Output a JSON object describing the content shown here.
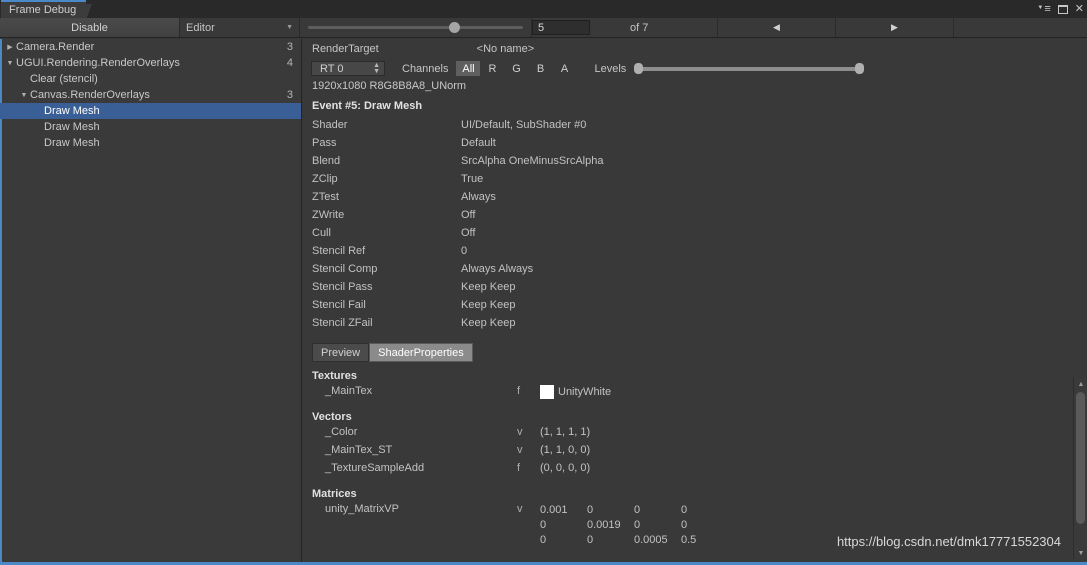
{
  "window": {
    "tab_title": "Frame Debug",
    "controls": {
      "menu": "menu-icon",
      "maximize": "maximize-icon",
      "close": "✕"
    }
  },
  "toolbar": {
    "disable_label": "Disable",
    "target_dropdown": "Editor",
    "frame_value": "5",
    "frame_total": "of 7",
    "prev_label": "◀",
    "next_label": "▶",
    "slider_percent": 68
  },
  "tree": {
    "items": [
      {
        "label": "Camera.Render",
        "count": "3",
        "arrow": "▶",
        "indent": 0,
        "selected": false
      },
      {
        "label": "UGUI.Rendering.RenderOverlays",
        "count": "4",
        "arrow": "▼",
        "indent": 0,
        "selected": false
      },
      {
        "label": "Clear (stencil)",
        "count": "",
        "arrow": "",
        "indent": 1,
        "selected": false
      },
      {
        "label": "Canvas.RenderOverlays",
        "count": "3",
        "arrow": "▼",
        "indent": 1,
        "selected": false
      },
      {
        "label": "Draw Mesh",
        "count": "",
        "arrow": "",
        "indent": 2,
        "selected": true
      },
      {
        "label": "Draw Mesh",
        "count": "",
        "arrow": "",
        "indent": 2,
        "selected": false
      },
      {
        "label": "Draw Mesh",
        "count": "",
        "arrow": "",
        "indent": 2,
        "selected": false
      }
    ]
  },
  "detail": {
    "render_target_label": "RenderTarget",
    "render_target_value": "<No name>",
    "rt_index": "RT 0",
    "channels_label": "Channels",
    "channels": [
      "All",
      "R",
      "G",
      "B",
      "A"
    ],
    "channel_active": "All",
    "levels_label": "Levels",
    "rt_format": "1920x1080 R8G8B8A8_UNorm",
    "event_title": "Event #5: Draw Mesh",
    "properties": [
      {
        "key": "Shader",
        "value": "UI/Default, SubShader #0"
      },
      {
        "key": "Pass",
        "value": "Default"
      },
      {
        "key": "Blend",
        "value": "SrcAlpha OneMinusSrcAlpha"
      },
      {
        "key": "ZClip",
        "value": "True"
      },
      {
        "key": "ZTest",
        "value": "Always"
      },
      {
        "key": "ZWrite",
        "value": "Off"
      },
      {
        "key": "Cull",
        "value": "Off"
      },
      {
        "key": "Stencil Ref",
        "value": "0"
      },
      {
        "key": "Stencil Comp",
        "value": "Always Always"
      },
      {
        "key": "Stencil Pass",
        "value": "Keep Keep"
      },
      {
        "key": "Stencil Fail",
        "value": "Keep Keep"
      },
      {
        "key": "Stencil ZFail",
        "value": "Keep Keep"
      }
    ],
    "tabs": [
      {
        "label": "Preview",
        "active": false
      },
      {
        "label": "ShaderProperties",
        "active": true
      }
    ],
    "textures_header": "Textures",
    "textures": [
      {
        "name": "_MainTex",
        "type": "f",
        "value": "UnityWhite",
        "swatch": "#ffffff"
      }
    ],
    "vectors_header": "Vectors",
    "vectors": [
      {
        "name": "_Color",
        "type": "v",
        "value": "(1, 1, 1, 1)"
      },
      {
        "name": "_MainTex_ST",
        "type": "v",
        "value": "(1, 1, 0, 0)"
      },
      {
        "name": "_TextureSampleAdd",
        "type": "f",
        "value": "(0, 0, 0, 0)"
      }
    ],
    "matrices_header": "Matrices",
    "matrices": [
      {
        "name": "unity_MatrixVP",
        "type": "v",
        "rows": [
          [
            "0.001",
            "0",
            "0",
            "0"
          ],
          [
            "0",
            "0.0019",
            "0",
            "0"
          ],
          [
            "0",
            "0",
            "0.0005",
            "0.5"
          ]
        ]
      }
    ]
  },
  "watermark": "https://blog.csdn.net/dmk17771552304"
}
